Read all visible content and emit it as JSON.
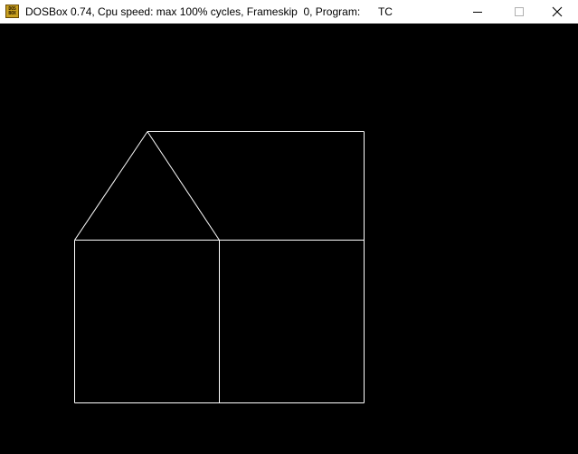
{
  "window": {
    "icon_label": "DOS BOX",
    "title": "DOSBox 0.74, Cpu speed: max 100% cycles, Frameskip  0, Program:      TC"
  },
  "controls": {
    "minimize": "minimize-icon",
    "maximize": "maximize-icon",
    "close": "close-icon"
  },
  "drawing": {
    "line_color": "#ffffff",
    "background": "#000000"
  }
}
